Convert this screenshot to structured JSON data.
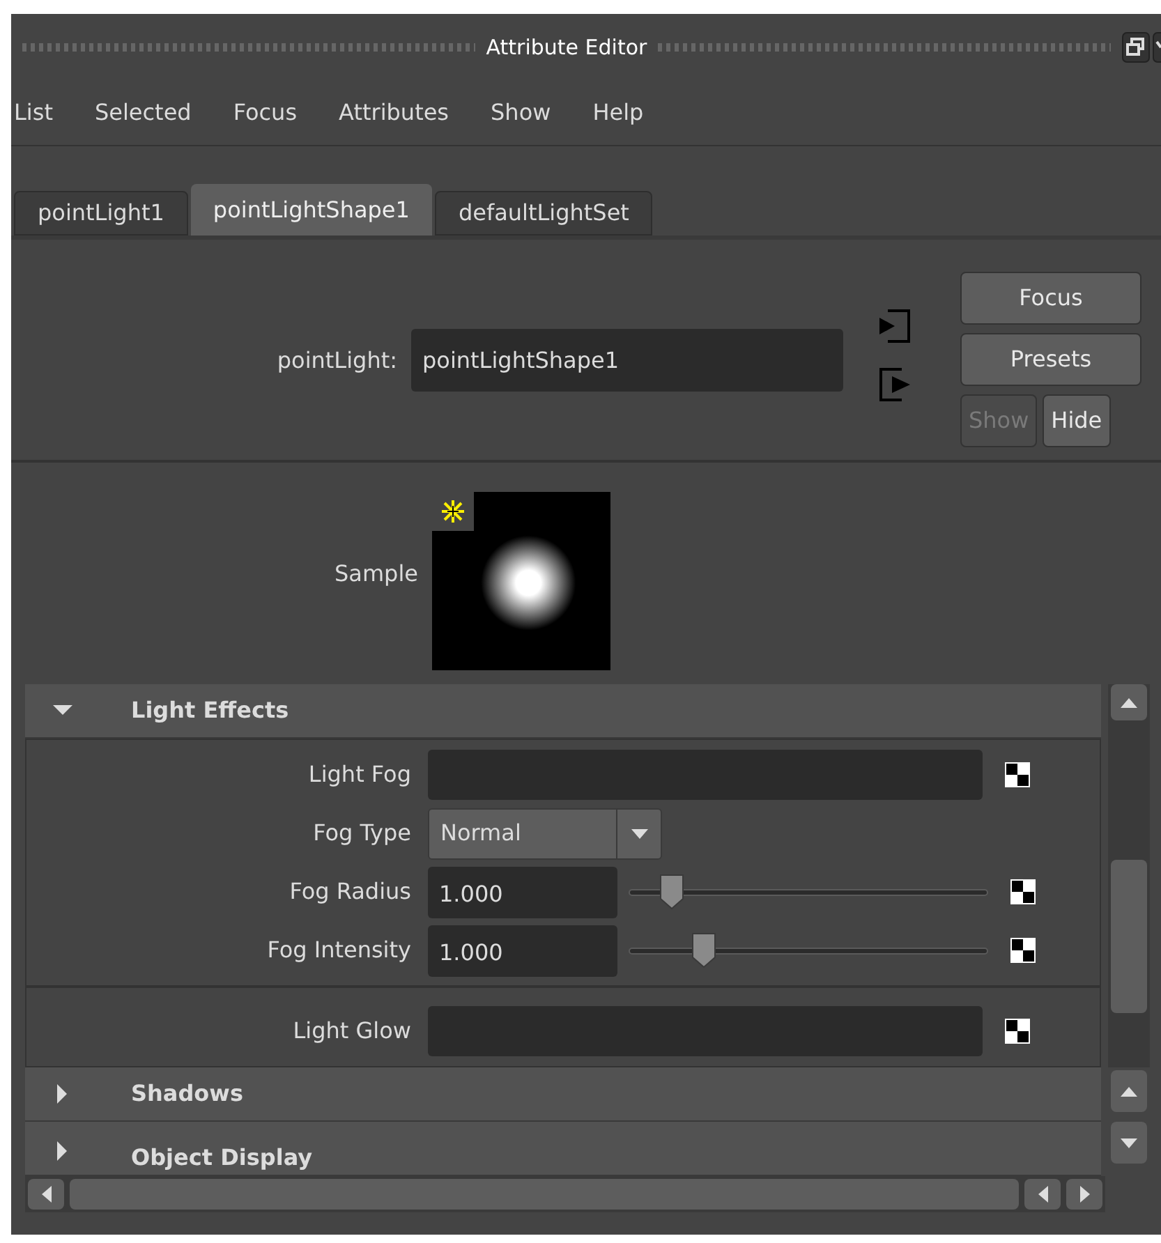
{
  "window": {
    "title": "Attribute Editor"
  },
  "menu": [
    "List",
    "Selected",
    "Focus",
    "Attributes",
    "Show",
    "Help"
  ],
  "tabs": [
    {
      "label": "pointLight1",
      "selected": false
    },
    {
      "label": "pointLightShape1",
      "selected": true
    },
    {
      "label": "defaultLightSet",
      "selected": false
    }
  ],
  "node": {
    "label": "pointLight:",
    "value": "pointLightShape1"
  },
  "buttons": [
    {
      "label": "Focus",
      "disabled": false
    },
    {
      "label": "Presets",
      "disabled": false
    },
    {
      "label": "Show",
      "disabled": true
    },
    {
      "label": "Hide",
      "disabled": false
    }
  ],
  "sample": {
    "label": "Sample"
  },
  "sections": [
    {
      "title": "Light Effects",
      "expanded": true,
      "groups": [
        [
          {
            "kind": "color",
            "label": "Light Fog"
          },
          {
            "kind": "dropdown",
            "label": "Fog Type",
            "value": "Normal"
          },
          {
            "kind": "slider",
            "label": "Fog Radius",
            "value": "1.000",
            "level": 0.12
          },
          {
            "kind": "slider",
            "label": "Fog Intensity",
            "value": "1.000",
            "level": 0.21
          }
        ],
        [
          {
            "kind": "color",
            "label": "Light Glow"
          }
        ]
      ]
    },
    {
      "title": "Shadows",
      "expanded": false
    },
    {
      "title": "Object Display",
      "expanded": false
    }
  ]
}
